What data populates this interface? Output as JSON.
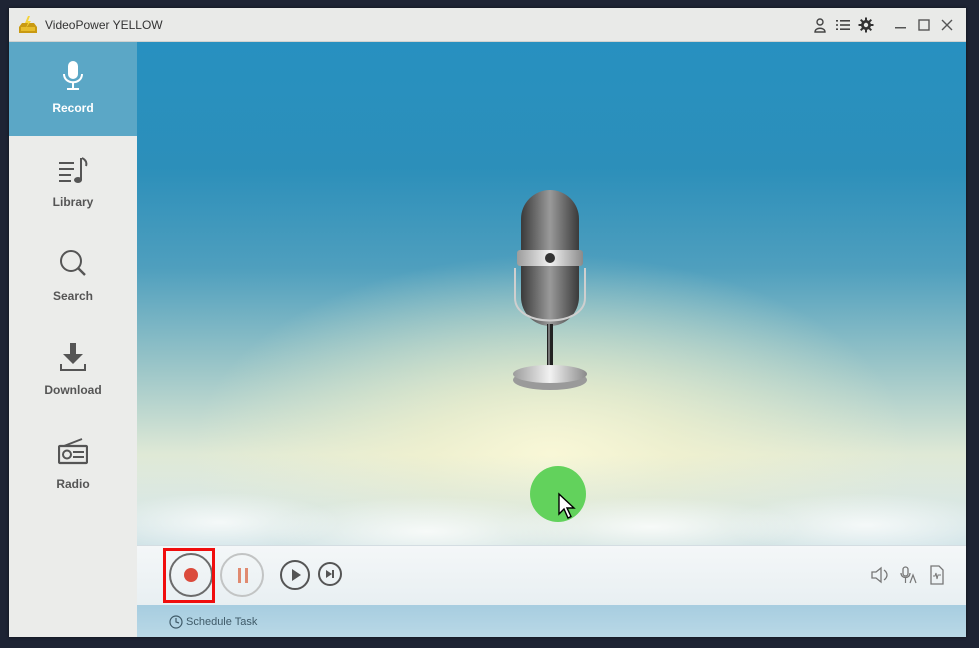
{
  "window": {
    "title": "VideoPower YELLOW",
    "titlebar_icons": [
      "user-icon",
      "list-menu-icon",
      "settings-icon"
    ],
    "window_controls": [
      "minimize",
      "maximize",
      "close"
    ]
  },
  "sidebar": {
    "items": [
      {
        "label": "Record",
        "icon": "microphone-icon",
        "active": true
      },
      {
        "label": "Library",
        "icon": "music-list-icon",
        "active": false
      },
      {
        "label": "Search",
        "icon": "search-icon",
        "active": false
      },
      {
        "label": "Download",
        "icon": "download-icon",
        "active": false
      },
      {
        "label": "Radio",
        "icon": "radio-icon",
        "active": false
      }
    ]
  },
  "main": {
    "illustration": "studio-microphone",
    "cursor_highlight_color": "#62d25c"
  },
  "controls": {
    "record": {
      "label": "Record",
      "highlighted": true,
      "highlight_color": "#f00d0d",
      "dot_color": "#db4b3c"
    },
    "pause": {
      "label": "Pause"
    },
    "play": {
      "label": "Play"
    },
    "next": {
      "label": "Next"
    },
    "right_icons": [
      "speaker-icon",
      "microphone-source-icon",
      "audio-file-icon"
    ]
  },
  "schedule": {
    "label": "Schedule Task",
    "icon": "clock-icon"
  },
  "colors": {
    "accent": "#5ba7c6",
    "sidebar_bg": "#ebecea",
    "desktop_bg": "#1e2434"
  }
}
